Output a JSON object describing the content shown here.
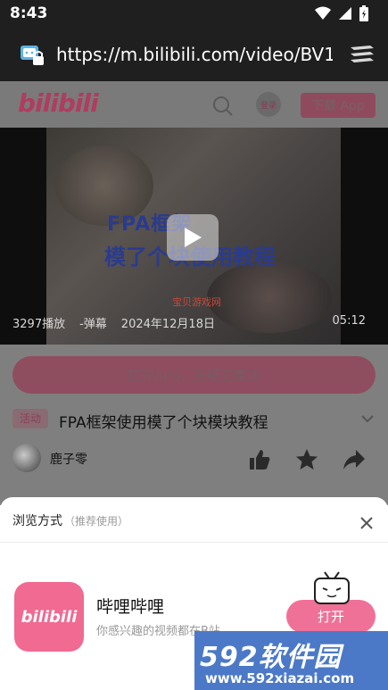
{
  "status_bar": {
    "time": "8:43"
  },
  "browser": {
    "url": "https://m.bilibili.com/video/BV1"
  },
  "header": {
    "logo": "bilibili",
    "login": "登录",
    "download": "下载 App"
  },
  "video": {
    "title_line1": "FPA框架",
    "title_line2": "模了个块使用教程",
    "watermark": "宝贝游戏网",
    "plays": "3297播放",
    "danmaku": "-弹幕",
    "date": "2024年12月18日",
    "duration": "05:12"
  },
  "page": {
    "open_app": "打开App，流畅又高清",
    "tag": "活动",
    "video_name": "FPA框架使用模了个块模块教程",
    "uploader": "鹿子零"
  },
  "sheet": {
    "title": "浏览方式",
    "subtitle": "（推荐使用）",
    "app_icon_text": "bilibili",
    "app_name": "哔哩哔哩",
    "app_desc": "你感兴趣的视频都在B站",
    "open_button": "打开"
  },
  "site_watermark": {
    "big": "592软件园",
    "small": "www.592xiazai.com"
  },
  "colors": {
    "accent": "#f07198",
    "bili_pink": "#fb7299",
    "status_bg": "#1f1f1f",
    "watermark_bg": "#4b79c7"
  }
}
